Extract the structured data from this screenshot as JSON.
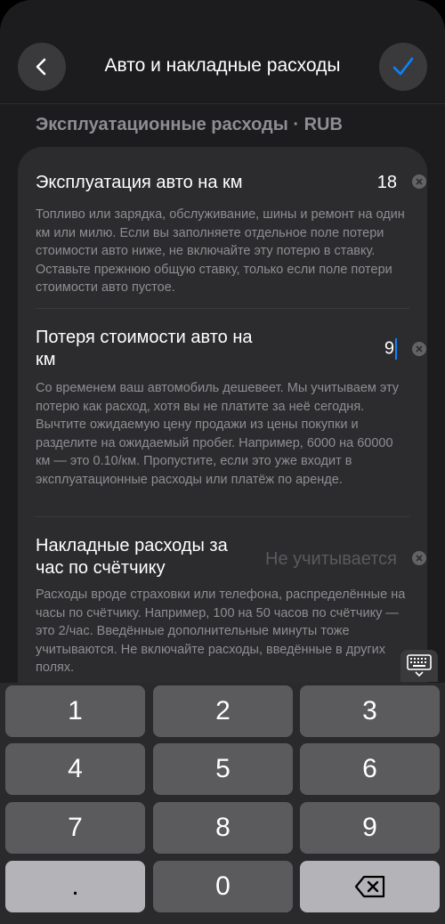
{
  "header": {
    "title": "Авто и накладные расходы",
    "back_icon": "chevron-left-icon",
    "confirm_icon": "checkmark-icon",
    "accent_color": "#0a84ff"
  },
  "section": {
    "title": "Эксплуатационные расходы · RUB"
  },
  "fields": [
    {
      "label": "Эксплуатация авто на км",
      "value": "18",
      "description": "Топливо или зарядка, обслуживание, шины и ремонт на один км или милю. Если вы заполняете отдельное поле потери стоимости авто ниже, не включайте эту потерю в ставку. Оставьте прежнюю общую ставку, только если поле потери стоимости авто пустое."
    },
    {
      "label": "Потеря стоимости авто на км",
      "value": "9",
      "description": "Со временем ваш автомобиль дешевеет. Мы учитываем эту потерю как расход, хотя вы не платите за неё сегодня. Вычтите ожидаемую цену продажи из цены покупки и разделите на ожидаемый пробег. Например, 6000 на 60000 км — это 0.10/км. Пропустите, если это уже входит в эксплуатационные расходы или платёж по аренде."
    },
    {
      "label": "Накладные расходы за час по счётчику",
      "placeholder": "Не учитывается",
      "description": "Расходы вроде страховки или телефона, распределённые на часы по счётчику. Например, 100 на 50 часов по счётчику — это 2/час. Введённые дополнительные минуты тоже учитываются. Не включайте расходы, введённые в других полях."
    }
  ],
  "keyboard": {
    "keys": [
      "1",
      "2",
      "3",
      "4",
      "5",
      "6",
      "7",
      "8",
      "9",
      ".",
      "0"
    ],
    "backspace_icon": "backspace-icon",
    "toggle_icon": "keyboard-dismiss-icon"
  }
}
